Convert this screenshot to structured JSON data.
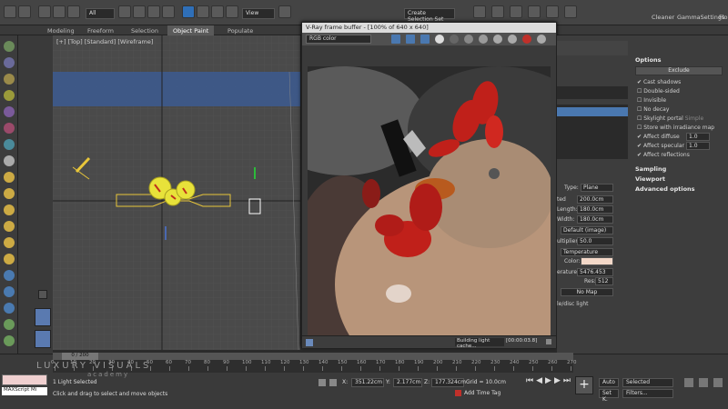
{
  "toolbar": {
    "selection_filter": "All",
    "view": "View",
    "create_selection_set": "Create Selection Set",
    "right_tabs": [
      "Cleaner",
      "GammaSettings",
      "Flo"
    ]
  },
  "ribbon": {
    "tabs": [
      "Modeling",
      "Freeform",
      "Selection",
      "Object Paint",
      "Populate"
    ],
    "active": "Object Paint"
  },
  "viewport": {
    "label": "[+] [Top] [Standard] [Wireframe]"
  },
  "vfb": {
    "title": "V-Ray frame buffer - [100% of 640 x 640]",
    "channel": "RGB color",
    "status": "Building light cache...",
    "timer": "[00:00:03.8]"
  },
  "options": {
    "title": "Options",
    "exclude": "Exclude",
    "checks": [
      {
        "label": "Cast shadows",
        "checked": true
      },
      {
        "label": "Double-sided",
        "checked": false
      },
      {
        "label": "Invisible",
        "checked": false
      },
      {
        "label": "No decay",
        "checked": false
      },
      {
        "label": "Skylight portal",
        "checked": false,
        "extra": "Simple"
      },
      {
        "label": "Store with irradiance map",
        "checked": false
      },
      {
        "label": "Affect diffuse",
        "checked": true,
        "value": "1.0"
      },
      {
        "label": "Affect specular",
        "checked": true,
        "value": "1.0"
      },
      {
        "label": "Affect reflections",
        "checked": true
      }
    ],
    "sections": [
      "Sampling",
      "Viewport",
      "Advanced options"
    ]
  },
  "light_params": {
    "type_label": "Type:",
    "type": "Plane",
    "rows": [
      {
        "label": "ted",
        "value": "200.0cm"
      },
      {
        "label": "Length:",
        "value": "180.0cm"
      },
      {
        "label": "Width:",
        "value": "180.0cm"
      }
    ],
    "default_image": "Default (image)",
    "multiplier_label": "ultiplier:",
    "multiplier": "50.0",
    "mode": "Temperature",
    "color_label": "Color:",
    "temperature_label": "erature:",
    "temperature": "5476.453",
    "res_label": "Res:",
    "res": "512",
    "nomap": "No Map",
    "disc_light": "le/disc light"
  },
  "timeline": {
    "frame": "0 / 200",
    "ticks": [
      "0",
      "10",
      "20",
      "30",
      "40",
      "50",
      "60",
      "70",
      "80",
      "90",
      "100",
      "110",
      "120",
      "130",
      "140",
      "150",
      "160",
      "170",
      "180",
      "190",
      "200",
      "210",
      "220",
      "230",
      "240",
      "250",
      "260",
      "270"
    ]
  },
  "watermark": {
    "line1": "LUXURY VISUALS",
    "line2": "academy"
  },
  "status": {
    "script": "MAXScript Mi",
    "selected": "1 Light Selected",
    "prompt": "Click and drag to select and move objects",
    "x": "351.22cm",
    "y": "2.177cm",
    "z": "177.324cm",
    "grid": "Grid = 10.0cm",
    "add_time_tag": "Add Time Tag",
    "auto": "Auto",
    "selected_dd": "Selected",
    "setk": "Set K.",
    "filters": "Filters..."
  },
  "colors": {
    "accent": "#2f6fb8",
    "light_yellow": "#e8e23a",
    "vfb_title": "#dcdcdc"
  }
}
